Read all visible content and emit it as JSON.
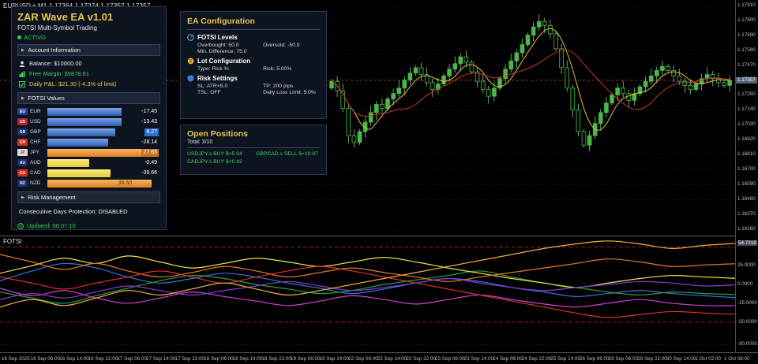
{
  "window": {
    "symbol_label": "EURUSD.s,M1  1.17364 1.17374 1.17357 1.17357"
  },
  "ea_panel": {
    "title": "ZAR Wave EA v1.01",
    "subtitle": "FOTSI Multi-Symbol Trading",
    "status": "ACTIVO",
    "sections": {
      "account": "Account Information",
      "fotsi": "FOTSI Values",
      "risk": "Risk Management"
    },
    "account": {
      "balance": "Balance: $10000.00",
      "free_margin": "Free Margin: $9878.81",
      "daily_pnl": "Daily P&L: $21.30 (-4.3% of limit)"
    },
    "fotsi_rows": [
      {
        "code": "EU",
        "name": "EUR",
        "value": "-17.45",
        "bar": 66,
        "kind": "blue",
        "flag": "#24408e"
      },
      {
        "code": "US",
        "name": "USD",
        "value": "-13.43",
        "bar": 66,
        "kind": "blue",
        "flag": "#b22234"
      },
      {
        "code": "GB",
        "name": "GBP",
        "value": "8.27",
        "bar": 60,
        "kind": "blue",
        "flag": "#1a2f6e",
        "hl": "#2f6fd0"
      },
      {
        "code": "CH",
        "name": "CHF",
        "value": "-28.14",
        "bar": 54,
        "kind": "blue",
        "flag": "#d52b1e"
      },
      {
        "code": "JP",
        "name": "JPY",
        "value": "27.65",
        "bar": 84,
        "kind": "orange",
        "flag": "#dcdcdc",
        "flag_text": "#c02020",
        "hl": "#c8761e"
      },
      {
        "code": "AU",
        "name": "AUD",
        "value": "-0.49",
        "bar": 37,
        "kind": "yellow",
        "flag": "#1a2f6e"
      },
      {
        "code": "CA",
        "name": "CAD",
        "value": "-39.66",
        "bar": 56,
        "kind": "yellow",
        "flag": "#d52b1e"
      },
      {
        "code": "NZ",
        "name": "NZD",
        "value": "38.50",
        "bar": 92,
        "kind": "orange",
        "flag": "#1a2f6e",
        "dark_text": true
      }
    ],
    "risk_text": "Consecutive Days Protection: DISABLED",
    "updated": "Updated: 06:07:10"
  },
  "ea_config": {
    "title": "EA Configuration",
    "sections": [
      {
        "heading": "FOTSI Levels",
        "lines": [
          [
            "Overbought: 50.0",
            "Oversold: -50.0"
          ],
          [
            "Min. Difference: 75.0",
            ""
          ]
        ]
      },
      {
        "heading": "Lot Configuration",
        "lines": [
          [
            "Type: Risk %",
            "Risk: 5.00%"
          ]
        ]
      },
      {
        "heading": "Risk Settings",
        "lines": [
          [
            "SL: ATR×5.0",
            "TP: 200 pips"
          ],
          [
            "TSL: OFF",
            "Daily Loss Limit: 5.0%"
          ]
        ]
      }
    ]
  },
  "positions": {
    "title": "Open Positions",
    "total": "Total: 3/10",
    "items": [
      "USDJPY.s BUY $+5.04",
      "GBPCAD.s SELL $+19.87",
      "CADJPY.s BUY $+0.42"
    ]
  },
  "chart": {
    "current_price": "1.17357",
    "price_labels": [
      "1.17910",
      "1.17800",
      "1.17690",
      "1.17580",
      "1.17470",
      "1.17360",
      "1.17250",
      "1.17140",
      "1.17030",
      "1.16920",
      "1.16810",
      "1.16700",
      "1.16590",
      "1.16480",
      "1.16370",
      "1.16260"
    ],
    "up_color": "#49b849",
    "down_color": "#050805",
    "ma_fast_color": "#d9c23a",
    "ma_slow_color": "#cc3333",
    "closes": [
      1.1735,
      1.1728,
      1.1715,
      1.1695,
      1.169,
      1.1698,
      1.1705,
      1.1712,
      1.1718,
      1.1715,
      1.1722,
      1.1726,
      1.173,
      1.1736,
      1.1741,
      1.1745,
      1.174,
      1.1734,
      1.1729,
      1.1733,
      1.1739,
      1.1744,
      1.1748,
      1.1753,
      1.1749,
      1.1742,
      1.1735,
      1.1729,
      1.1724,
      1.173,
      1.1737,
      1.1744,
      1.175,
      1.1756,
      1.1762,
      1.1769,
      1.1775,
      1.1779,
      1.1776,
      1.177,
      1.1759,
      1.1745,
      1.173,
      1.1714,
      1.1698,
      1.1688,
      1.1695,
      1.1704,
      1.1712,
      1.1719,
      1.1725,
      1.173,
      1.1726,
      1.1721,
      1.1726,
      1.1731,
      1.1735,
      1.1739,
      1.1743,
      1.1746,
      1.1743,
      1.1739,
      1.1735,
      1.1732,
      1.1729,
      1.1733,
      1.1737,
      1.174,
      1.1737,
      1.1734,
      1.1732,
      1.17357
    ]
  },
  "indicator": {
    "label": "FOTSI",
    "scale_labels": [
      {
        "text": "54.7219",
        "v": 54.72
      },
      {
        "text": "25.0000",
        "v": 25
      },
      {
        "text": "0.0000",
        "v": 0
      },
      {
        "text": "-25.0000",
        "v": -25
      },
      {
        "text": "-50.0000",
        "v": -50
      },
      {
        "text": "-80.0000",
        "v": -80
      }
    ],
    "levels": [
      {
        "v": 50,
        "style": "red-dash"
      },
      {
        "v": -50,
        "style": "red-dash"
      },
      {
        "v": 25,
        "style": "dot"
      },
      {
        "v": 0,
        "style": "dot"
      },
      {
        "v": -25,
        "style": "dot"
      },
      {
        "v": -80,
        "style": "dot"
      }
    ],
    "series": [
      {
        "name": "EUR",
        "color": "#3d6fe0",
        "values": [
          5,
          18,
          28,
          22,
          10,
          2,
          8,
          15,
          10,
          2,
          -5,
          -12,
          -6,
          2,
          8,
          4,
          -4,
          -10,
          -16,
          -12,
          -8,
          -12,
          -15,
          -17.45
        ]
      },
      {
        "name": "USD",
        "color": "#2e9e3e",
        "values": [
          -10,
          -18,
          -25,
          -15,
          -5,
          5,
          12,
          8,
          0,
          -6,
          -12,
          -8,
          0,
          6,
          12,
          18,
          10,
          2,
          -4,
          -10,
          -14,
          -10,
          -12,
          -13.43
        ]
      },
      {
        "name": "GBP",
        "color": "#e8e84a",
        "values": [
          15,
          25,
          35,
          28,
          38,
          30,
          22,
          28,
          35,
          30,
          24,
          30,
          36,
          30,
          22,
          15,
          8,
          2,
          -4,
          2,
          8,
          12,
          10,
          8.27
        ]
      },
      {
        "name": "CHF",
        "color": "#d040d0",
        "values": [
          -5,
          -15,
          -8,
          -18,
          -25,
          -18,
          -10,
          -16,
          -22,
          -28,
          -22,
          -15,
          -20,
          -26,
          -20,
          -14,
          -20,
          -26,
          -30,
          -25,
          -20,
          -25,
          -28,
          -28.14
        ]
      },
      {
        "name": "JPY",
        "color": "#e87820",
        "values": [
          40,
          30,
          20,
          28,
          18,
          10,
          16,
          24,
          18,
          10,
          16,
          22,
          16,
          10,
          4,
          10,
          16,
          22,
          28,
          34,
          30,
          24,
          26,
          27.65
        ]
      },
      {
        "name": "AUD",
        "color": "#8040d0",
        "values": [
          -20,
          -12,
          -18,
          -10,
          -2,
          -8,
          -14,
          -8,
          -2,
          4,
          -2,
          -8,
          -4,
          2,
          8,
          2,
          -4,
          -8,
          -4,
          0,
          4,
          2,
          -2,
          -0.49
        ]
      },
      {
        "name": "CAD",
        "color": "#e03030",
        "values": [
          10,
          2,
          -6,
          2,
          10,
          18,
          10,
          2,
          10,
          18,
          24,
          18,
          10,
          2,
          -6,
          -14,
          -22,
          -30,
          -38,
          -44,
          -40,
          -36,
          -38,
          -39.66
        ]
      },
      {
        "name": "NZD",
        "color": "#f0b040",
        "values": [
          -30,
          -20,
          -28,
          -18,
          -8,
          -14,
          -6,
          2,
          -6,
          -14,
          -8,
          0,
          8,
          16,
          24,
          32,
          40,
          48,
          54,
          58,
          54,
          48,
          52,
          54.72
        ]
      }
    ]
  },
  "time_axis": {
    "labels": [
      "16 Sep 2025",
      "16 Sep 06:00",
      "16 Sep 14:00",
      "16 Sep 22:00",
      "17 Sep 06:00",
      "17 Sep 14:00",
      "17 Sep 22:00",
      "18 Sep 06:00",
      "18 Sep 14:00",
      "18 Sep 22:00",
      "19 Sep 06:00",
      "19 Sep 14:00",
      "22 Sep 06:00",
      "22 Sep 14:00",
      "22 Sep 22:00",
      "23 Sep 06:00",
      "23 Sep 14:00",
      "24 Sep 06:00",
      "24 Sep 22:00",
      "25 Sep 14:00",
      "26 Sep 06:00",
      "29 Sep 06:00",
      "29 Sep 22:00",
      "30 Sep 14:00",
      "1 Oct 02:00",
      "1 Oct 08:00"
    ]
  }
}
